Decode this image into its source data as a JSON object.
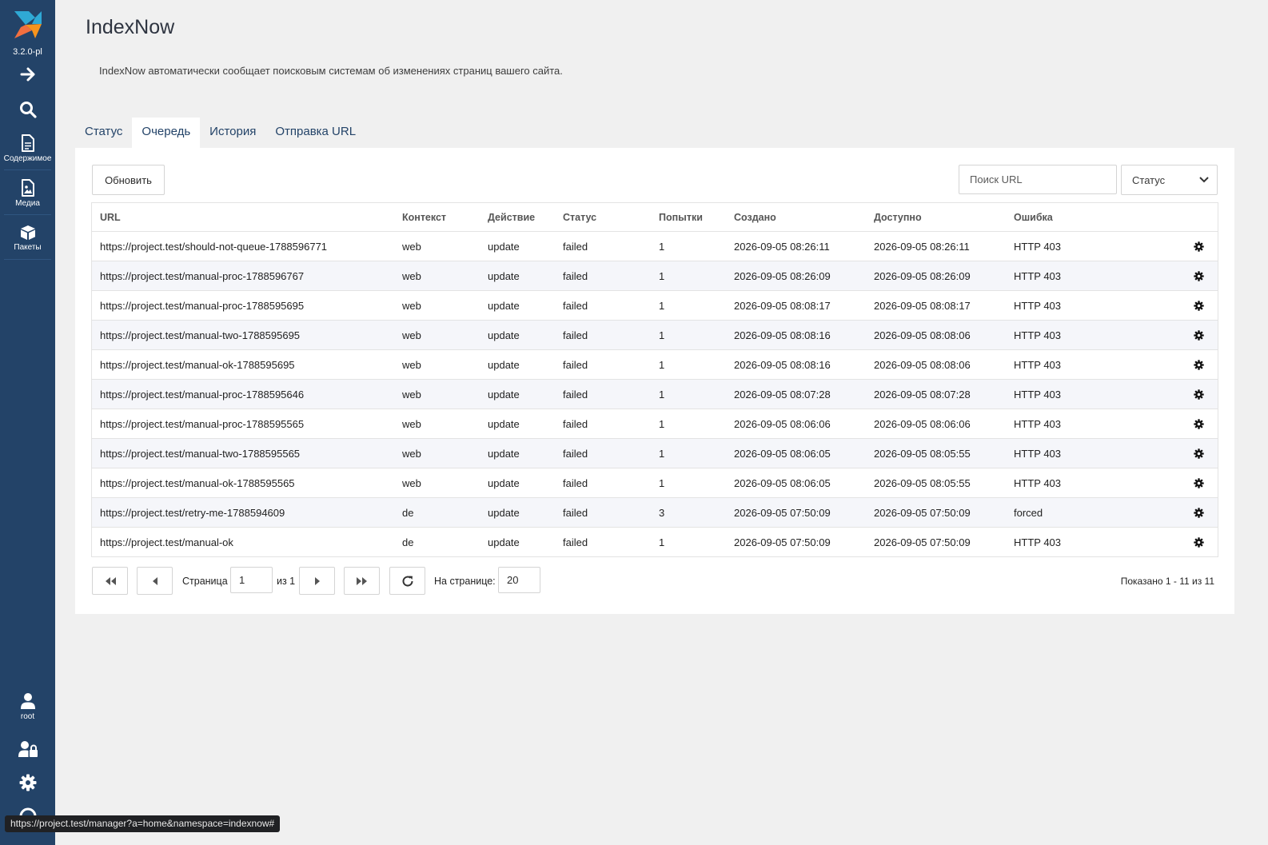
{
  "sidebar": {
    "version": "3.2.0-pl",
    "items": [
      {
        "icon": "arrow-right-icon",
        "label": ""
      },
      {
        "icon": "search-icon",
        "label": ""
      },
      {
        "icon": "document-icon",
        "label": "Содержимое"
      },
      {
        "icon": "media-icon",
        "label": "Медиа"
      },
      {
        "icon": "package-icon",
        "label": "Пакеты"
      }
    ],
    "bottom": [
      {
        "icon": "user-icon",
        "label": "root"
      },
      {
        "icon": "user-lock-icon",
        "label": ""
      },
      {
        "icon": "gear-icon",
        "label": ""
      },
      {
        "icon": "help-icon",
        "label": ""
      }
    ]
  },
  "page": {
    "title": "IndexNow",
    "description": "IndexNow автоматически сообщает поисковым системам об изменениях страниц вашего сайта."
  },
  "tabs": [
    {
      "label": "Статус",
      "active": false
    },
    {
      "label": "Очередь",
      "active": true
    },
    {
      "label": "История",
      "active": false
    },
    {
      "label": "Отправка URL",
      "active": false
    }
  ],
  "toolbar": {
    "refresh_label": "Обновить",
    "search_placeholder": "Поиск URL",
    "status_select": "Статус"
  },
  "table": {
    "columns": [
      "URL",
      "Контекст",
      "Действие",
      "Статус",
      "Попытки",
      "Создано",
      "Доступно",
      "Ошибка"
    ],
    "rows": [
      [
        "https://project.test/should-not-queue-1788596771",
        "web",
        "update",
        "failed",
        "1",
        "2026-09-05 08:26:11",
        "2026-09-05 08:26:11",
        "HTTP 403"
      ],
      [
        "https://project.test/manual-proc-1788596767",
        "web",
        "update",
        "failed",
        "1",
        "2026-09-05 08:26:09",
        "2026-09-05 08:26:09",
        "HTTP 403"
      ],
      [
        "https://project.test/manual-proc-1788595695",
        "web",
        "update",
        "failed",
        "1",
        "2026-09-05 08:08:17",
        "2026-09-05 08:08:17",
        "HTTP 403"
      ],
      [
        "https://project.test/manual-two-1788595695",
        "web",
        "update",
        "failed",
        "1",
        "2026-09-05 08:08:16",
        "2026-09-05 08:08:06",
        "HTTP 403"
      ],
      [
        "https://project.test/manual-ok-1788595695",
        "web",
        "update",
        "failed",
        "1",
        "2026-09-05 08:08:16",
        "2026-09-05 08:08:06",
        "HTTP 403"
      ],
      [
        "https://project.test/manual-proc-1788595646",
        "web",
        "update",
        "failed",
        "1",
        "2026-09-05 08:07:28",
        "2026-09-05 08:07:28",
        "HTTP 403"
      ],
      [
        "https://project.test/manual-proc-1788595565",
        "web",
        "update",
        "failed",
        "1",
        "2026-09-05 08:06:06",
        "2026-09-05 08:06:06",
        "HTTP 403"
      ],
      [
        "https://project.test/manual-two-1788595565",
        "web",
        "update",
        "failed",
        "1",
        "2026-09-05 08:06:05",
        "2026-09-05 08:05:55",
        "HTTP 403"
      ],
      [
        "https://project.test/manual-ok-1788595565",
        "web",
        "update",
        "failed",
        "1",
        "2026-09-05 08:06:05",
        "2026-09-05 08:05:55",
        "HTTP 403"
      ],
      [
        "https://project.test/retry-me-1788594609",
        "de",
        "update",
        "failed",
        "3",
        "2026-09-05 07:50:09",
        "2026-09-05 07:50:09",
        "forced"
      ],
      [
        "https://project.test/manual-ok",
        "de",
        "update",
        "failed",
        "1",
        "2026-09-05 07:50:09",
        "2026-09-05 07:50:09",
        "HTTP 403"
      ]
    ]
  },
  "pagination": {
    "page_label": "Страница",
    "page_value": "1",
    "of_label": "из 1",
    "per_page_label": "На странице:",
    "per_page_value": "20",
    "shown": "Показано 1 - 11 из 11"
  },
  "statusbar": "https://project.test/manager?a=home&namespace=indexnow#",
  "colors": {
    "sidebar": "#234368",
    "accent": "#234368",
    "panel": "#ffffff",
    "background": "#f0f0f0"
  }
}
